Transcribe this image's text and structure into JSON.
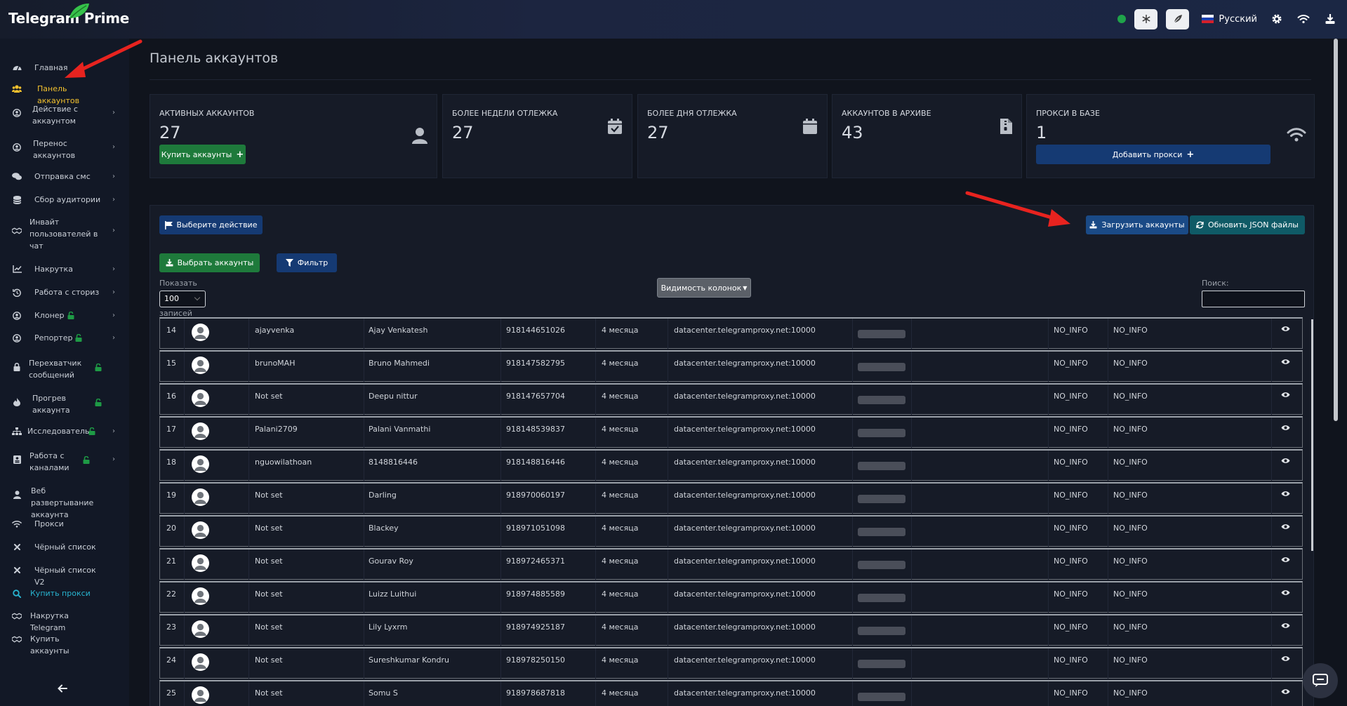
{
  "app": {
    "brand": "Telegram Prime"
  },
  "topbar": {
    "language": "Русский"
  },
  "sidebar": {
    "items": [
      {
        "label": "Главная",
        "icon": "gauge-icon",
        "chevron": false,
        "lock": false,
        "state": ""
      },
      {
        "label": "Панель аккаунтов",
        "icon": "users-icon",
        "chevron": false,
        "lock": false,
        "state": "active"
      },
      {
        "label": "Действие с аккаунтом",
        "icon": "user-circle-icon",
        "chevron": true,
        "lock": false,
        "state": ""
      },
      {
        "label": "Перенос аккаунтов",
        "icon": "user-circle-icon",
        "chevron": true,
        "lock": false,
        "state": ""
      },
      {
        "label": "Отправка смс",
        "icon": "comments-icon",
        "chevron": true,
        "lock": false,
        "state": ""
      },
      {
        "label": "Сбор аудитории",
        "icon": "database-icon",
        "chevron": true,
        "lock": false,
        "state": ""
      },
      {
        "label": "Инвайт пользователей в чат",
        "icon": "handshake-icon",
        "chevron": true,
        "lock": false,
        "state": ""
      },
      {
        "label": "Накрутка",
        "icon": "chart-icon",
        "chevron": true,
        "lock": false,
        "state": ""
      },
      {
        "label": "Работа с сториз",
        "icon": "history-icon",
        "chevron": true,
        "lock": false,
        "state": ""
      },
      {
        "label": "Клонер",
        "icon": "user-circle-icon",
        "chevron": true,
        "lock": true,
        "state": ""
      },
      {
        "label": "Репортер",
        "icon": "user-circle-icon",
        "chevron": true,
        "lock": true,
        "state": ""
      },
      {
        "label": "Перехватчик сообщений",
        "icon": "lock-icon",
        "chevron": false,
        "lock": true,
        "state": ""
      },
      {
        "label": "Прогрев аккаунта",
        "icon": "fire-icon",
        "chevron": false,
        "lock": true,
        "state": ""
      },
      {
        "label": "Исследователь",
        "icon": "sitemap-icon",
        "chevron": true,
        "lock": true,
        "state": ""
      },
      {
        "label": "Работа с каналами",
        "icon": "channel-icon",
        "chevron": true,
        "lock": true,
        "state": ""
      },
      {
        "label": "Веб развертывание аккаунта",
        "icon": "user-icon",
        "chevron": false,
        "lock": false,
        "state": ""
      },
      {
        "label": "Прокси",
        "icon": "wifi-icon",
        "chevron": false,
        "lock": false,
        "state": ""
      },
      {
        "label": "Чёрный список",
        "icon": "x-icon",
        "chevron": false,
        "lock": false,
        "state": ""
      },
      {
        "label": "Чёрный список V2",
        "icon": "x-icon",
        "chevron": false,
        "lock": false,
        "state": ""
      },
      {
        "label": "Купить прокси",
        "icon": "search-icon",
        "chevron": false,
        "lock": false,
        "state": "cyan"
      },
      {
        "label": "Накрутка Telegram",
        "icon": "handshake-icon",
        "chevron": false,
        "lock": false,
        "state": ""
      },
      {
        "label": "Купить аккаунты",
        "icon": "handshake-icon",
        "chevron": false,
        "lock": false,
        "state": ""
      }
    ]
  },
  "page": {
    "title": "Панель аккаунтов"
  },
  "cards": [
    {
      "label": "Активных аккаунтов",
      "value": "27",
      "button": "Купить аккаунты",
      "icon": "user-icon"
    },
    {
      "label": "Более недели отлежка",
      "value": "27",
      "icon": "calendar-check-icon"
    },
    {
      "label": "Более дня отлежка",
      "value": "27",
      "icon": "calendar-icon"
    },
    {
      "label": "Аккаунтов в архиве",
      "value": "43",
      "icon": "archive-file-icon"
    },
    {
      "label": "Прокси в базе",
      "value": "1",
      "button": "Добавить прокси",
      "icon": "wifi-icon"
    }
  ],
  "toolbar": {
    "select_action": "Выберите действие",
    "upload_accounts": "Загрузить аккаунты",
    "refresh_json": "Обновить JSON файлы",
    "choose_accounts": "Выбрать аккаунты",
    "filter": "Фильтр",
    "columns_visibility": "Видимость колонок",
    "show_label": "Показать",
    "show_value": "100",
    "records_label": "записей",
    "search_label": "Поиск:"
  },
  "table": {
    "rows": [
      {
        "n": "14",
        "username": "ajayvenka",
        "name": "Ajay Venkatesh",
        "phone": "918144651026",
        "age": "4 месяца",
        "proxy": "datacenter.telegramproxy.net:10000",
        "info1": "NO_INFO",
        "info2": "NO_INFO"
      },
      {
        "n": "15",
        "username": "brunoMAH",
        "name": "Bruno Mahmedi",
        "phone": "918147582795",
        "age": "4 месяца",
        "proxy": "datacenter.telegramproxy.net:10000",
        "info1": "NO_INFO",
        "info2": "NO_INFO"
      },
      {
        "n": "16",
        "username": "Not set",
        "name": "Deepu nittur",
        "phone": "918147657704",
        "age": "4 месяца",
        "proxy": "datacenter.telegramproxy.net:10000",
        "info1": "NO_INFO",
        "info2": "NO_INFO"
      },
      {
        "n": "17",
        "username": "Palani2709",
        "name": "Palani Vanmathi",
        "phone": "918148539837",
        "age": "4 месяца",
        "proxy": "datacenter.telegramproxy.net:10000",
        "info1": "NO_INFO",
        "info2": "NO_INFO"
      },
      {
        "n": "18",
        "username": "nguowilathoan",
        "name": "8148816446",
        "phone": "918148816446",
        "age": "4 месяца",
        "proxy": "datacenter.telegramproxy.net:10000",
        "info1": "NO_INFO",
        "info2": "NO_INFO"
      },
      {
        "n": "19",
        "username": "Not set",
        "name": "Darling",
        "phone": "918970060197",
        "age": "4 месяца",
        "proxy": "datacenter.telegramproxy.net:10000",
        "info1": "NO_INFO",
        "info2": "NO_INFO"
      },
      {
        "n": "20",
        "username": "Not set",
        "name": "Blackey",
        "phone": "918971051098",
        "age": "4 месяца",
        "proxy": "datacenter.telegramproxy.net:10000",
        "info1": "NO_INFO",
        "info2": "NO_INFO"
      },
      {
        "n": "21",
        "username": "Not set",
        "name": "Gourav Roy",
        "phone": "918972465371",
        "age": "4 месяца",
        "proxy": "datacenter.telegramproxy.net:10000",
        "info1": "NO_INFO",
        "info2": "NO_INFO"
      },
      {
        "n": "22",
        "username": "Not set",
        "name": "Luizz Luithui",
        "phone": "918974885589",
        "age": "4 месяца",
        "proxy": "datacenter.telegramproxy.net:10000",
        "info1": "NO_INFO",
        "info2": "NO_INFO"
      },
      {
        "n": "23",
        "username": "Not set",
        "name": "Lily Lyxrm",
        "phone": "918974925187",
        "age": "4 месяца",
        "proxy": "datacenter.telegramproxy.net:10000",
        "info1": "NO_INFO",
        "info2": "NO_INFO"
      },
      {
        "n": "24",
        "username": "Not set",
        "name": "Sureshkumar Kondru",
        "phone": "918978250150",
        "age": "4 месяца",
        "proxy": "datacenter.telegramproxy.net:10000",
        "info1": "NO_INFO",
        "info2": "NO_INFO"
      },
      {
        "n": "25",
        "username": "Not set",
        "name": "Somu S",
        "phone": "918978687818",
        "age": "4 месяца",
        "proxy": "datacenter.telegramproxy.net:10000",
        "info1": "NO_INFO",
        "info2": "NO_INFO"
      }
    ]
  },
  "colors": {
    "active": "#f2c12e",
    "cyan": "#28b3cf",
    "green_button": "#1e7a3b",
    "navy_button": "#153a73",
    "teal_button": "#0f5a66",
    "status_online": "#1fa34a",
    "annotation_arrow": "#e8231f"
  }
}
